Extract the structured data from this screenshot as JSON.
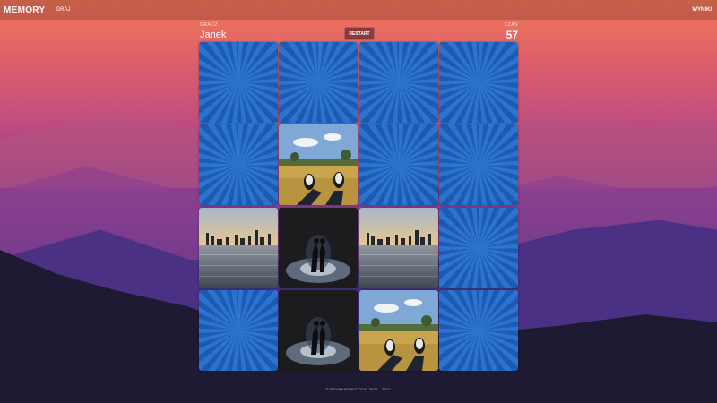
{
  "nav": {
    "brand": "MEMORY",
    "play": "GRAJ",
    "results": "WYNIKI"
  },
  "game": {
    "player_label": "GRACZ",
    "player_name": "Janek",
    "restart_label": "RESTART",
    "time_label": "CZAS",
    "time_value": "57"
  },
  "cards": [
    "back",
    "back",
    "back",
    "back",
    "back",
    "shoes-field",
    "back",
    "back",
    "city-skyline",
    "couple-night",
    "city-skyline",
    "back",
    "back",
    "couple-night",
    "shoes-field",
    "back"
  ],
  "footer": "© SZYMANOWICCOIC 2020 - 2021"
}
